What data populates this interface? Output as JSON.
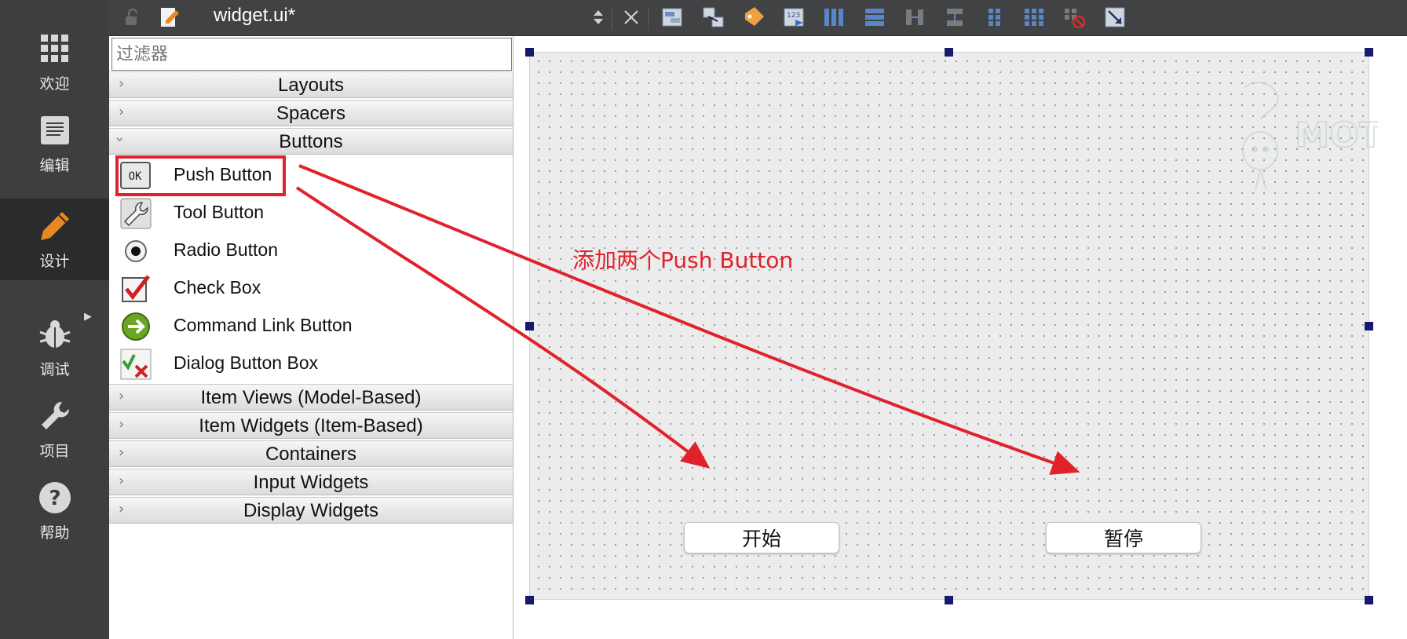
{
  "modebar": {
    "items": [
      {
        "label": "欢迎",
        "icon": "grid-icon"
      },
      {
        "label": "编辑",
        "icon": "document-icon"
      },
      {
        "label": "设计",
        "icon": "pencil-icon",
        "active": true
      },
      {
        "label": "调试",
        "icon": "bug-icon"
      },
      {
        "label": "项目",
        "icon": "wrench-icon"
      },
      {
        "label": "帮助",
        "icon": "help-icon"
      }
    ]
  },
  "toolbar": {
    "file_title": "widget.ui*"
  },
  "widgetbox": {
    "filter_placeholder": "过滤器",
    "categories": {
      "layouts": "Layouts",
      "spacers": "Spacers",
      "buttons": "Buttons",
      "item_views": "Item Views (Model-Based)",
      "item_widgets": "Item Widgets (Item-Based)",
      "containers": "Containers",
      "input_widgets": "Input Widgets",
      "display_widgets": "Display Widgets"
    },
    "button_items": [
      {
        "label": "Push Button",
        "icon": "ok-button-icon"
      },
      {
        "label": "Tool Button",
        "icon": "tool-button-icon"
      },
      {
        "label": "Radio Button",
        "icon": "radio-button-icon"
      },
      {
        "label": "Check Box",
        "icon": "check-box-icon"
      },
      {
        "label": "Command Link Button",
        "icon": "command-link-icon"
      },
      {
        "label": "Dialog Button Box",
        "icon": "dialog-button-box-icon"
      }
    ]
  },
  "form": {
    "button_start": "开始",
    "button_pause": "暂停",
    "watermark_text": "MOT"
  },
  "annotation": {
    "text": "添加两个Push Button",
    "color": "#e0222c"
  },
  "colors": {
    "sidebar_bg": "#3d3e40",
    "sidebar_active": "#2a2b2d",
    "toolbar_bg": "#404244",
    "selection_handle": "#17186f"
  }
}
